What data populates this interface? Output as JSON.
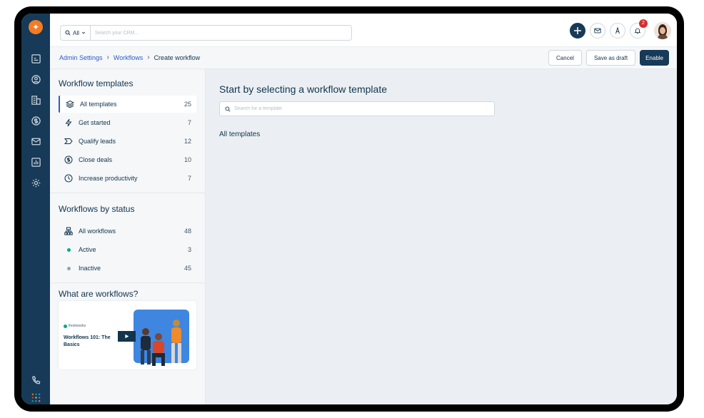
{
  "topbar": {
    "scope_label": "All",
    "search_placeholder": "Search your CRM...",
    "notification_count": "2"
  },
  "breadcrumb": {
    "admin": "Admin Settings",
    "workflows": "Workflows",
    "current": "Create workflow"
  },
  "header_buttons": {
    "cancel": "Cancel",
    "save_draft": "Save as draft",
    "enable": "Enable"
  },
  "templates": {
    "title": "Workflow templates",
    "items": [
      {
        "label": "All templates",
        "count": "25",
        "icon": "layers-icon"
      },
      {
        "label": "Get started",
        "count": "7",
        "icon": "lightning-icon"
      },
      {
        "label": "Qualify leads",
        "count": "12",
        "icon": "chevron-funnel-icon"
      },
      {
        "label": "Close deals",
        "count": "10",
        "icon": "dollar-icon"
      },
      {
        "label": "Increase productivity",
        "count": "7",
        "icon": "clock-icon"
      }
    ]
  },
  "status": {
    "title": "Workflows by status",
    "items": [
      {
        "label": "All workflows",
        "count": "48",
        "icon": "hierarchy-icon"
      },
      {
        "label": "Active",
        "count": "3",
        "color": "#00a886"
      },
      {
        "label": "Inactive",
        "count": "45",
        "color": "#92a2b1"
      }
    ]
  },
  "about": {
    "title": "What are workflows?",
    "brand": "freshworks",
    "video_title": "Workflows 101: The Basics"
  },
  "main": {
    "title": "Start by selecting a workflow template",
    "search_placeholder": "Search for a template",
    "section_label": "All templates"
  },
  "colors": {
    "nav": "#163a57",
    "accent": "#2c5cc5",
    "logo": "#f57b22",
    "badge": "#d72d30"
  }
}
